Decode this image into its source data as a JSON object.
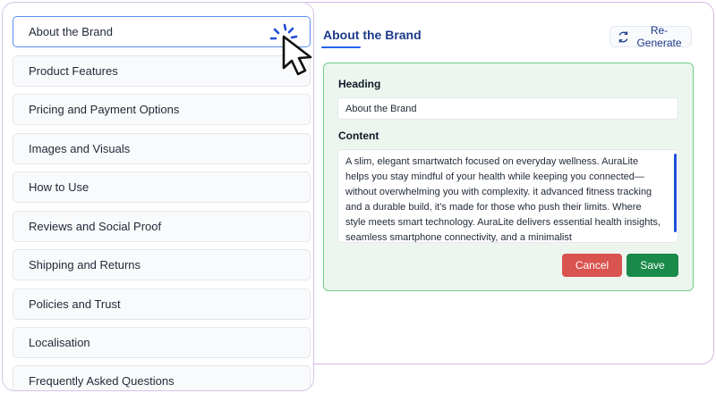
{
  "sidebar": {
    "items": [
      {
        "label": "About the Brand"
      },
      {
        "label": "Product Features"
      },
      {
        "label": "Pricing and Payment Options"
      },
      {
        "label": "Images and Visuals"
      },
      {
        "label": "How to Use"
      },
      {
        "label": "Reviews and Social Proof"
      },
      {
        "label": "Shipping and Returns"
      },
      {
        "label": "Policies and Trust"
      },
      {
        "label": "Localisation"
      },
      {
        "label": "Frequently Asked Questions"
      }
    ],
    "active_index": 0
  },
  "editor": {
    "section_title": "About the Brand",
    "regenerate_label": "Re-Generate",
    "heading_label": "Heading",
    "heading_value": "About the Brand",
    "content_label": "Content",
    "content_value": "A slim, elegant smartwatch focused on everyday wellness. AuraLite helps you stay mindful of your health while keeping you connected—without overwhelming you with complexity. it advanced fitness tracking and a durable build, it’s made for those who push their limits. Where style meets smart technology. AuraLite delivers essential health insights, seamless smartphone connectivity, and a minimalist",
    "cancel_label": "Cancel",
    "save_label": "Save"
  },
  "icons": {
    "regenerate": "refresh-icon",
    "cursor": "mouse-pointer-icon"
  },
  "colors": {
    "accent": "#1e3a8a",
    "cancel": "#d9534f",
    "save": "#198a4a",
    "card_bg": "#ecf6ef",
    "card_border": "#6fcf8b"
  }
}
